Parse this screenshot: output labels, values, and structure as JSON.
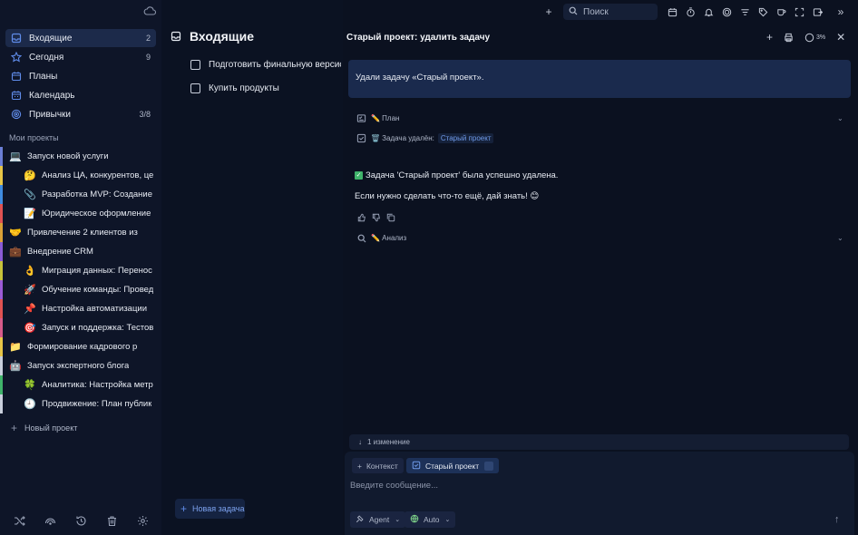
{
  "topbar": {
    "search_placeholder": "Поиск"
  },
  "sidebar": {
    "nav": [
      {
        "label": "Входящие",
        "count": "2",
        "icon": "inbox-icon",
        "active": true
      },
      {
        "label": "Сегодня",
        "count": "9",
        "icon": "star-icon"
      },
      {
        "label": "Планы",
        "count": "",
        "icon": "calendar-icon"
      },
      {
        "label": "Календарь",
        "count": "",
        "icon": "calendar-grid-icon"
      },
      {
        "label": "Привычки",
        "count": "3/8",
        "icon": "target-icon"
      }
    ],
    "section_title": "Мои проекты",
    "projects": [
      {
        "emoji": "💻",
        "label": "Запуск новой услуги",
        "level": "top",
        "color": "#6b7fd6"
      },
      {
        "emoji": "🤔",
        "label": "Анализ ЦА, конкурентов, це",
        "level": "sub",
        "color": "#e7c547"
      },
      {
        "emoji": "📎",
        "label": "Разработка MVP: Создание",
        "level": "sub",
        "color": "#3f8be0"
      },
      {
        "emoji": "📝",
        "label": "Юридическое оформление",
        "level": "sub",
        "color": "#e05252"
      },
      {
        "emoji": "🤝",
        "label": "Привлечение 2 клиентов из",
        "level": "top",
        "color": "#d9a037"
      },
      {
        "emoji": "💼",
        "label": "Внедрение CRM",
        "level": "top",
        "color": "#8a5bd6"
      },
      {
        "emoji": "👌",
        "label": "Миграция данных: Перенос",
        "level": "sub",
        "color": "#c6c23a"
      },
      {
        "emoji": "🚀",
        "label": "Обучение команды: Провед",
        "level": "sub",
        "color": "#9c5bd6"
      },
      {
        "emoji": "📌",
        "label": "Настройка автоматизации",
        "level": "sub",
        "color": "#e05252"
      },
      {
        "emoji": "🎯",
        "label": "Запуск и поддержка: Тестов",
        "level": "sub",
        "color": "#d65b8a"
      },
      {
        "emoji": "📁",
        "label": "Формирование кадрового р",
        "level": "top",
        "color": "#e7c547"
      },
      {
        "emoji": "🤖",
        "label": "Запуск экспертного блога",
        "level": "top",
        "color": "#c9cfdc"
      },
      {
        "emoji": "🍀",
        "label": "Аналитика: Настройка метр",
        "level": "sub",
        "color": "#3fb36a"
      },
      {
        "emoji": "🕘",
        "label": "Продвижение: План публик",
        "level": "sub",
        "color": "#c9cfdc"
      }
    ],
    "new_project": "Новый проект"
  },
  "content": {
    "title": "Входящие",
    "tasks": [
      "Подготовить финальную версис",
      "Купить продукты"
    ],
    "new_task": "Новая задача"
  },
  "panel": {
    "title": "Старый проект: удалить задачу",
    "context_pct": "3%",
    "user_message": "Удали задачу «Старый проект».",
    "plan_label": "✏️ План",
    "deleted_label": "🗑️ Задача удалён:",
    "deleted_tag": "Старый проект",
    "reply_line1": "Задача 'Старый проект' была успешно удалена.",
    "reply_line2": "Если нужно сделать что-то ещё, дай знать! 😊",
    "analysis_label": "✏️ Анализ",
    "changes_label": "1 изменение",
    "composer": {
      "context_chip": "Контекст",
      "project_chip": "Старый проект",
      "placeholder": "Введите сообщение...",
      "agent_label": "Agent",
      "model_label": "Auto"
    }
  },
  "colors": {
    "accent": "#5f8be8",
    "active_bg": "#1c2a4a",
    "success": "#3fb36a"
  }
}
